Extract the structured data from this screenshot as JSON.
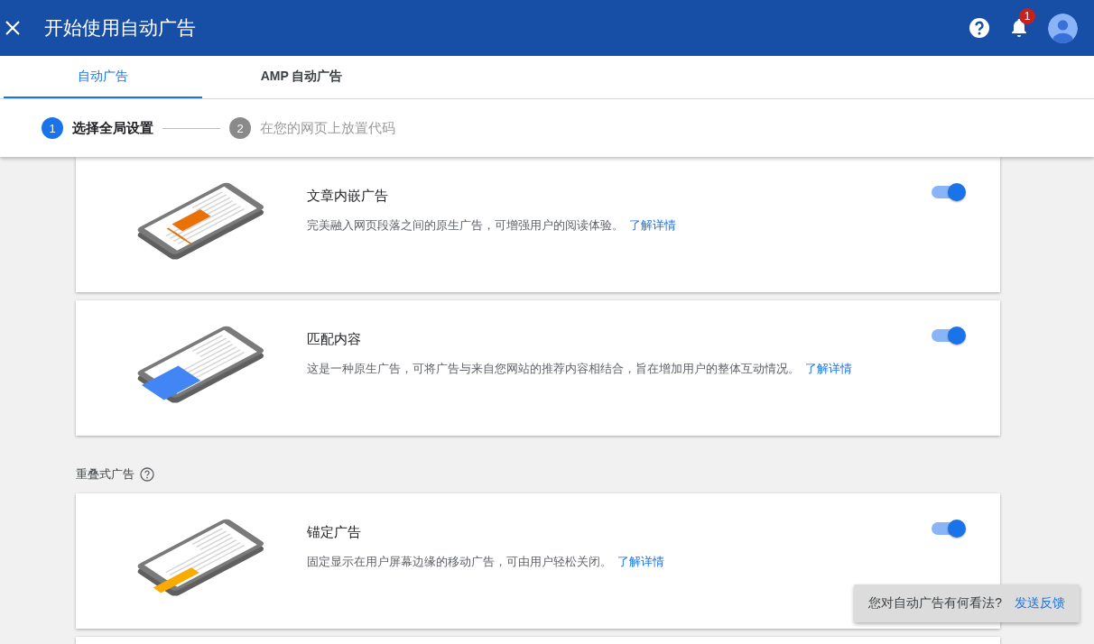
{
  "header": {
    "title": "开始使用自动广告",
    "notification_count": "1"
  },
  "tabs": [
    {
      "label": "自动广告",
      "selected": true
    },
    {
      "label": "AMP 自动广告",
      "selected": false
    }
  ],
  "steps": [
    {
      "number": "1",
      "label": "选择全局设置",
      "selected": true
    },
    {
      "number": "2",
      "label": "在您的网页上放置代码",
      "selected": false
    }
  ],
  "cards": [
    {
      "kind": "in-article",
      "title": "文章内嵌广告",
      "description": "完美融入网页段落之间的原生广告，可增强用户的阅读体验。",
      "link": "了解详情",
      "on": true
    },
    {
      "kind": "matched",
      "title": "匹配内容",
      "description": "这是一种原生广告，可将广告与来自您网站的推荐内容相结合，旨在增加用户的整体互动情况。",
      "link": "了解详情",
      "on": true
    }
  ],
  "overlay_section": {
    "title": "重叠式广告",
    "cards": [
      {
        "kind": "anchor",
        "title": "锚定广告",
        "description": "固定显示在用户屏幕边缘的移动广告，可由用户轻松关闭。",
        "link": "了解详情",
        "on": true
      }
    ]
  },
  "snackbar": {
    "text": "您对自动广告有何看法?",
    "action": "发送反馈"
  }
}
